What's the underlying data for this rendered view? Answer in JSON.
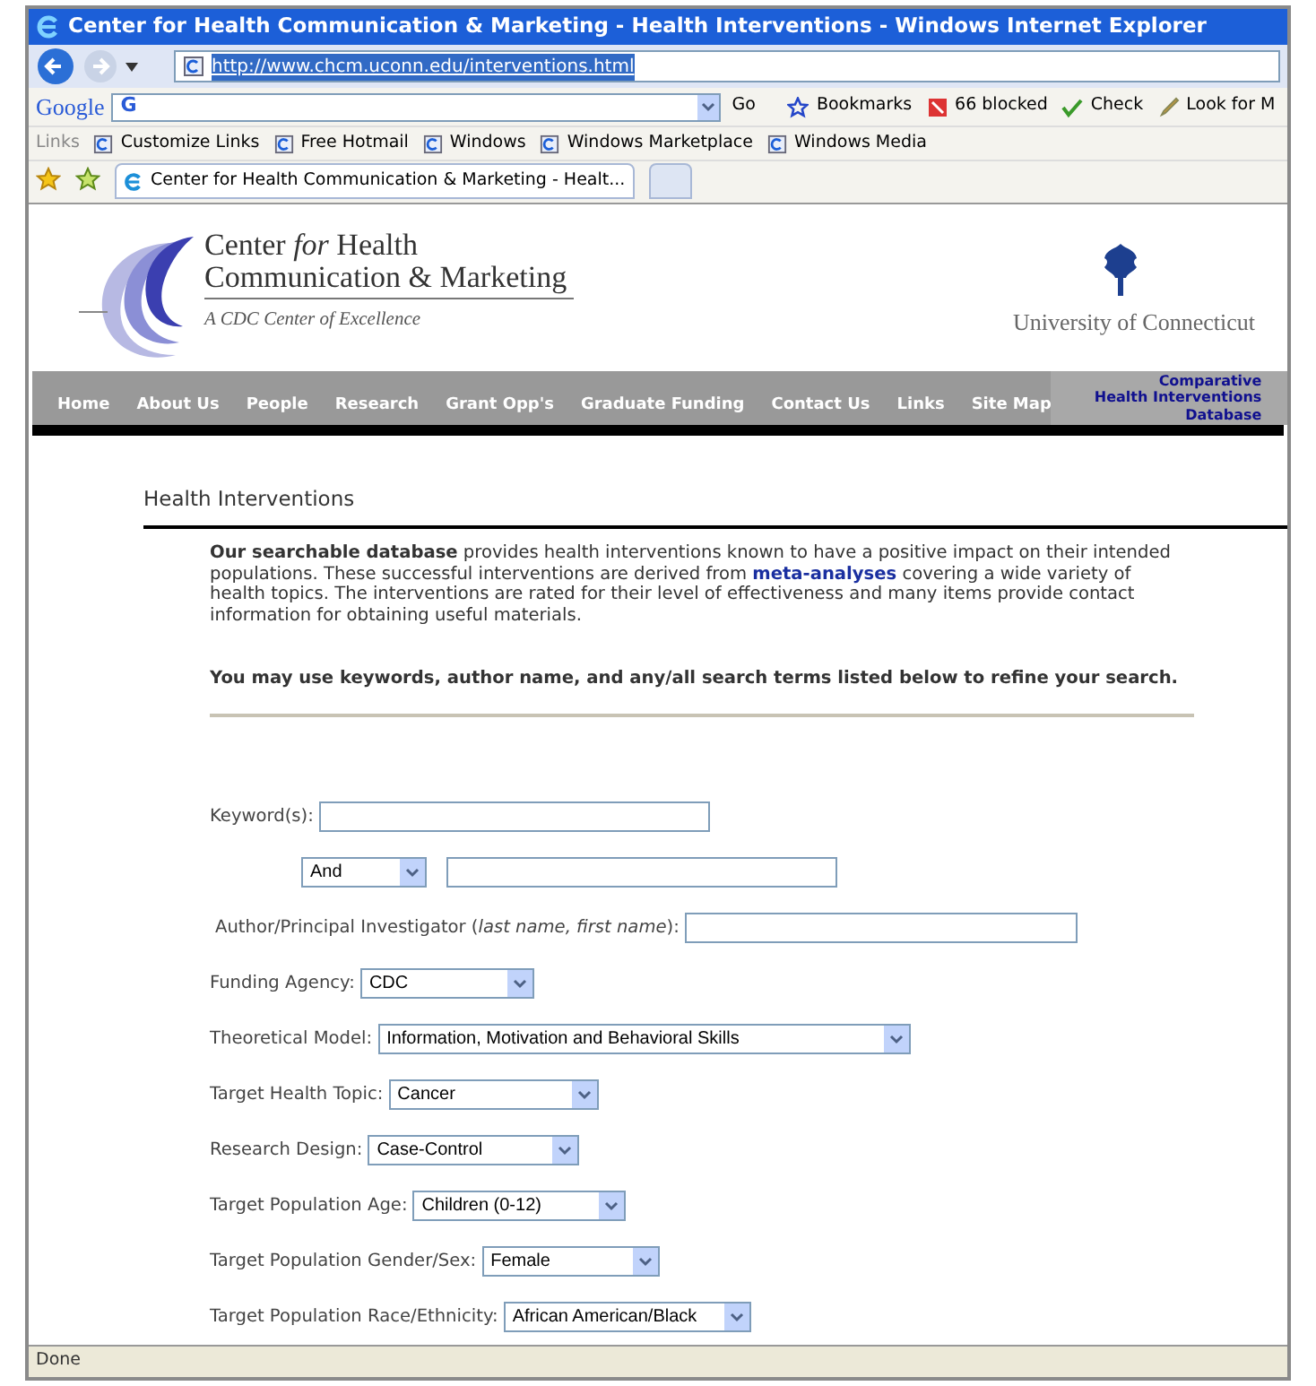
{
  "window": {
    "title": "Center for Health Communication & Marketing - Health Interventions - Windows Internet Explorer"
  },
  "address": {
    "url": "http://www.chcm.uconn.edu/interventions.html"
  },
  "google_toolbar": {
    "logo": "Google",
    "search_menu": "G",
    "go": "Go",
    "items": [
      "Bookmarks",
      "66 blocked",
      "Check",
      "Look for M"
    ]
  },
  "links_bar": {
    "label": "Links",
    "items": [
      "Customize Links",
      "Free Hotmail",
      "Windows",
      "Windows Marketplace",
      "Windows Media"
    ]
  },
  "tabs": [
    {
      "label": "Center for Health Communication & Marketing - Healt...",
      "selected": true
    }
  ],
  "site": {
    "logo_lines": [
      "Center *for* Health",
      "Communication & Marketing"
    ],
    "tagline": "A CDC Center of Excellence",
    "university": "University of Connecticut",
    "nav": [
      "Home",
      "About Us",
      "People",
      "Research",
      "Grant Opp's",
      "Graduate Funding",
      "Contact Us",
      "Links",
      "Site Map"
    ],
    "nav_badge": [
      "Comparative",
      "Health Interventions",
      "Database"
    ]
  },
  "heading": "Health Interventions",
  "intro": [
    {
      "kind": "bold",
      "text": "Our searchable database"
    },
    {
      "kind": "plain",
      "text": " provides health interventions known to have a positive impact on their intended populations.  These successful interventions are derived from "
    },
    {
      "kind": "link",
      "text": "meta-analyses"
    },
    {
      "kind": "plain",
      "text": " covering a wide variety of health topics.  The interventions are rated for their level of effectiveness and many items provide contact information for obtaining useful materials."
    }
  ],
  "instruction": "You may use keywords, author name, and any/all search terms listed below to refine your search.",
  "form": [
    {
      "kind": "text",
      "label": "Keyword(s):"
    },
    {
      "kind": "operator",
      "value": "And"
    },
    {
      "kind": "text",
      "label": "Author/Principal Investigator (*last name, first name*):"
    },
    {
      "kind": "select",
      "label": "Funding Agency:",
      "value": "CDC"
    },
    {
      "kind": "select",
      "label": "Theoretical Model:",
      "value": "Information, Motivation and Behavioral Skills"
    },
    {
      "kind": "select",
      "label": "Target Health Topic:",
      "value": "Cancer"
    },
    {
      "kind": "select",
      "label": "Research Design:",
      "value": "Case-Control"
    },
    {
      "kind": "select",
      "label": "Target Population Age:",
      "value": "Children (0-12)"
    },
    {
      "kind": "select",
      "label": "Target Population Gender/Sex:",
      "value": "Female"
    },
    {
      "kind": "select",
      "label": "Target Population Race/Ethnicity:",
      "value": "African American/Black"
    }
  ],
  "status_bar": {
    "text": "Done"
  }
}
